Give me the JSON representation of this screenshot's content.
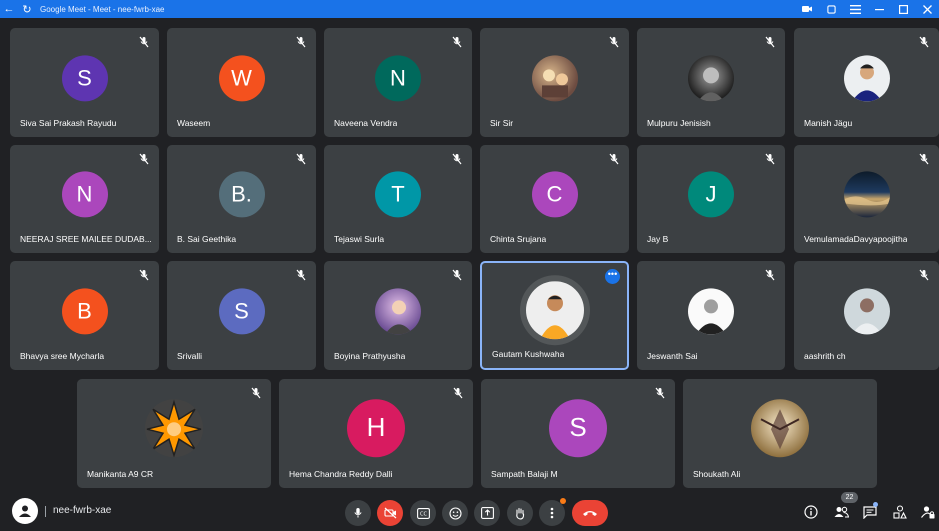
{
  "window": {
    "title": "Google Meet - Meet - nee-fwrb-xae"
  },
  "participants_row1": [
    {
      "name": "Siva Sai Prakash Rayudu",
      "initial": "S",
      "color": "#5e35b1",
      "photo": false
    },
    {
      "name": "Waseem",
      "initial": "W",
      "color": "#f4511e",
      "photo": false
    },
    {
      "name": "Naveena Vendra",
      "initial": "N",
      "color": "#00695c",
      "photo": false
    },
    {
      "name": "Sir Sir",
      "initial": "",
      "color": "#8d6e63",
      "photo": true
    },
    {
      "name": "Mulpuru Jenisish",
      "initial": "",
      "color": "#424242",
      "photo": true
    },
    {
      "name": "Manish Jägu",
      "initial": "",
      "color": "#cfd8dc",
      "photo": true
    }
  ],
  "participants_row2": [
    {
      "name": "NEERAJ SREE MAILEE DUDAB...",
      "initial": "N",
      "color": "#ab47bc",
      "photo": false
    },
    {
      "name": "B. Sai Geethika",
      "initial": "B.",
      "color": "#546e7a",
      "photo": false
    },
    {
      "name": "Tejaswi Surla",
      "initial": "T",
      "color": "#0097a7",
      "photo": false
    },
    {
      "name": "Chinta Srujana",
      "initial": "C",
      "color": "#ab47bc",
      "photo": false
    },
    {
      "name": "Jay B",
      "initial": "J",
      "color": "#00897b",
      "photo": false
    },
    {
      "name": "VemulamadaDavyapoojitha",
      "initial": "",
      "color": "#1e3a5f",
      "photo": true
    }
  ],
  "participants_row3": [
    {
      "name": "Bhavya sree Mycharla",
      "initial": "B",
      "color": "#f4511e",
      "photo": false
    },
    {
      "name": "Srivalli",
      "initial": "S",
      "color": "#5c6bc0",
      "photo": false
    },
    {
      "name": "Boyina Prathyusha",
      "initial": "",
      "color": "#8e7cc3",
      "photo": true
    },
    {
      "name": "Gautam Kushwaha",
      "initial": "",
      "color": "#ef6c00",
      "photo": true
    },
    {
      "name": "Jeswanth Sai",
      "initial": "",
      "color": "#e0e0e0",
      "photo": true
    },
    {
      "name": "aashrith ch",
      "initial": "",
      "color": "#b0bec5",
      "photo": true
    }
  ],
  "participants_row4": [
    {
      "name": "Manikanta A9 CR",
      "initial": "",
      "color": "#ff9800",
      "photo": true
    },
    {
      "name": "Hema Chandra Reddy Dalli",
      "initial": "H",
      "color": "#d81b60",
      "photo": false
    },
    {
      "name": "Sampath Balaji M",
      "initial": "S",
      "color": "#ab47bc",
      "photo": false
    },
    {
      "name": "Shoukath Ali",
      "initial": "",
      "color": "#c8a36a",
      "photo": true
    }
  ],
  "bottom_bar": {
    "meeting_code": "nee-fwrb-xae",
    "participant_count": "22"
  },
  "colors": {
    "accent": "#1a73e8",
    "tile": "#3c4043",
    "background": "#202124",
    "danger": "#ea4335"
  }
}
